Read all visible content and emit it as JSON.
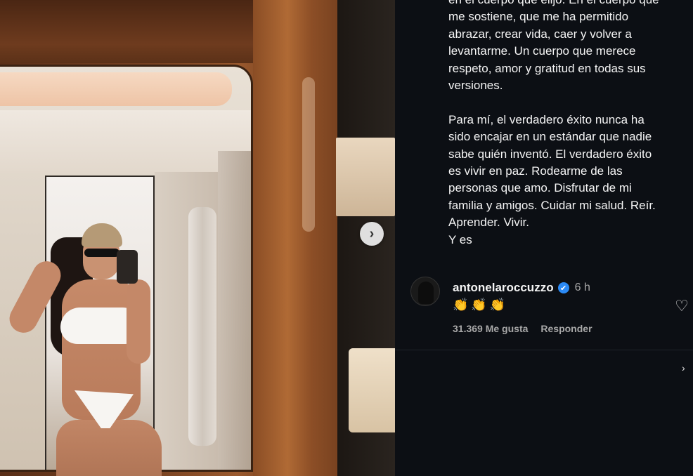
{
  "caption": {
    "lines": [
      "en el cuerpo que elijo. En el cuerpo que",
      "me sostiene, que me ha permitido",
      "abrazar, crear vida, caer y volver a",
      "levantarme. Un cuerpo que merece",
      "respeto, amor y gratitud en todas sus",
      "versiones.",
      "",
      "Para mí, el verdadero éxito nunca ha",
      "sido encajar en un estándar que nadie",
      "sabe quién inventó. El verdadero éxito",
      "es vivir en paz. Rodearme de las",
      "personas que amo. Disfrutar de mi",
      "familia y amigos. Cuidar mi salud. Reír.",
      "Aprender. Vivir.",
      "Y es"
    ]
  },
  "comment": {
    "username": "antonelaroccuzzo",
    "verified_icon": "✔",
    "time": "6 h",
    "emojis": "👏👏👏",
    "likes": "31.369 Me gusta",
    "reply": "Responder"
  },
  "icons": {
    "next": "›",
    "heart": "♡",
    "side_arrow": "›"
  }
}
